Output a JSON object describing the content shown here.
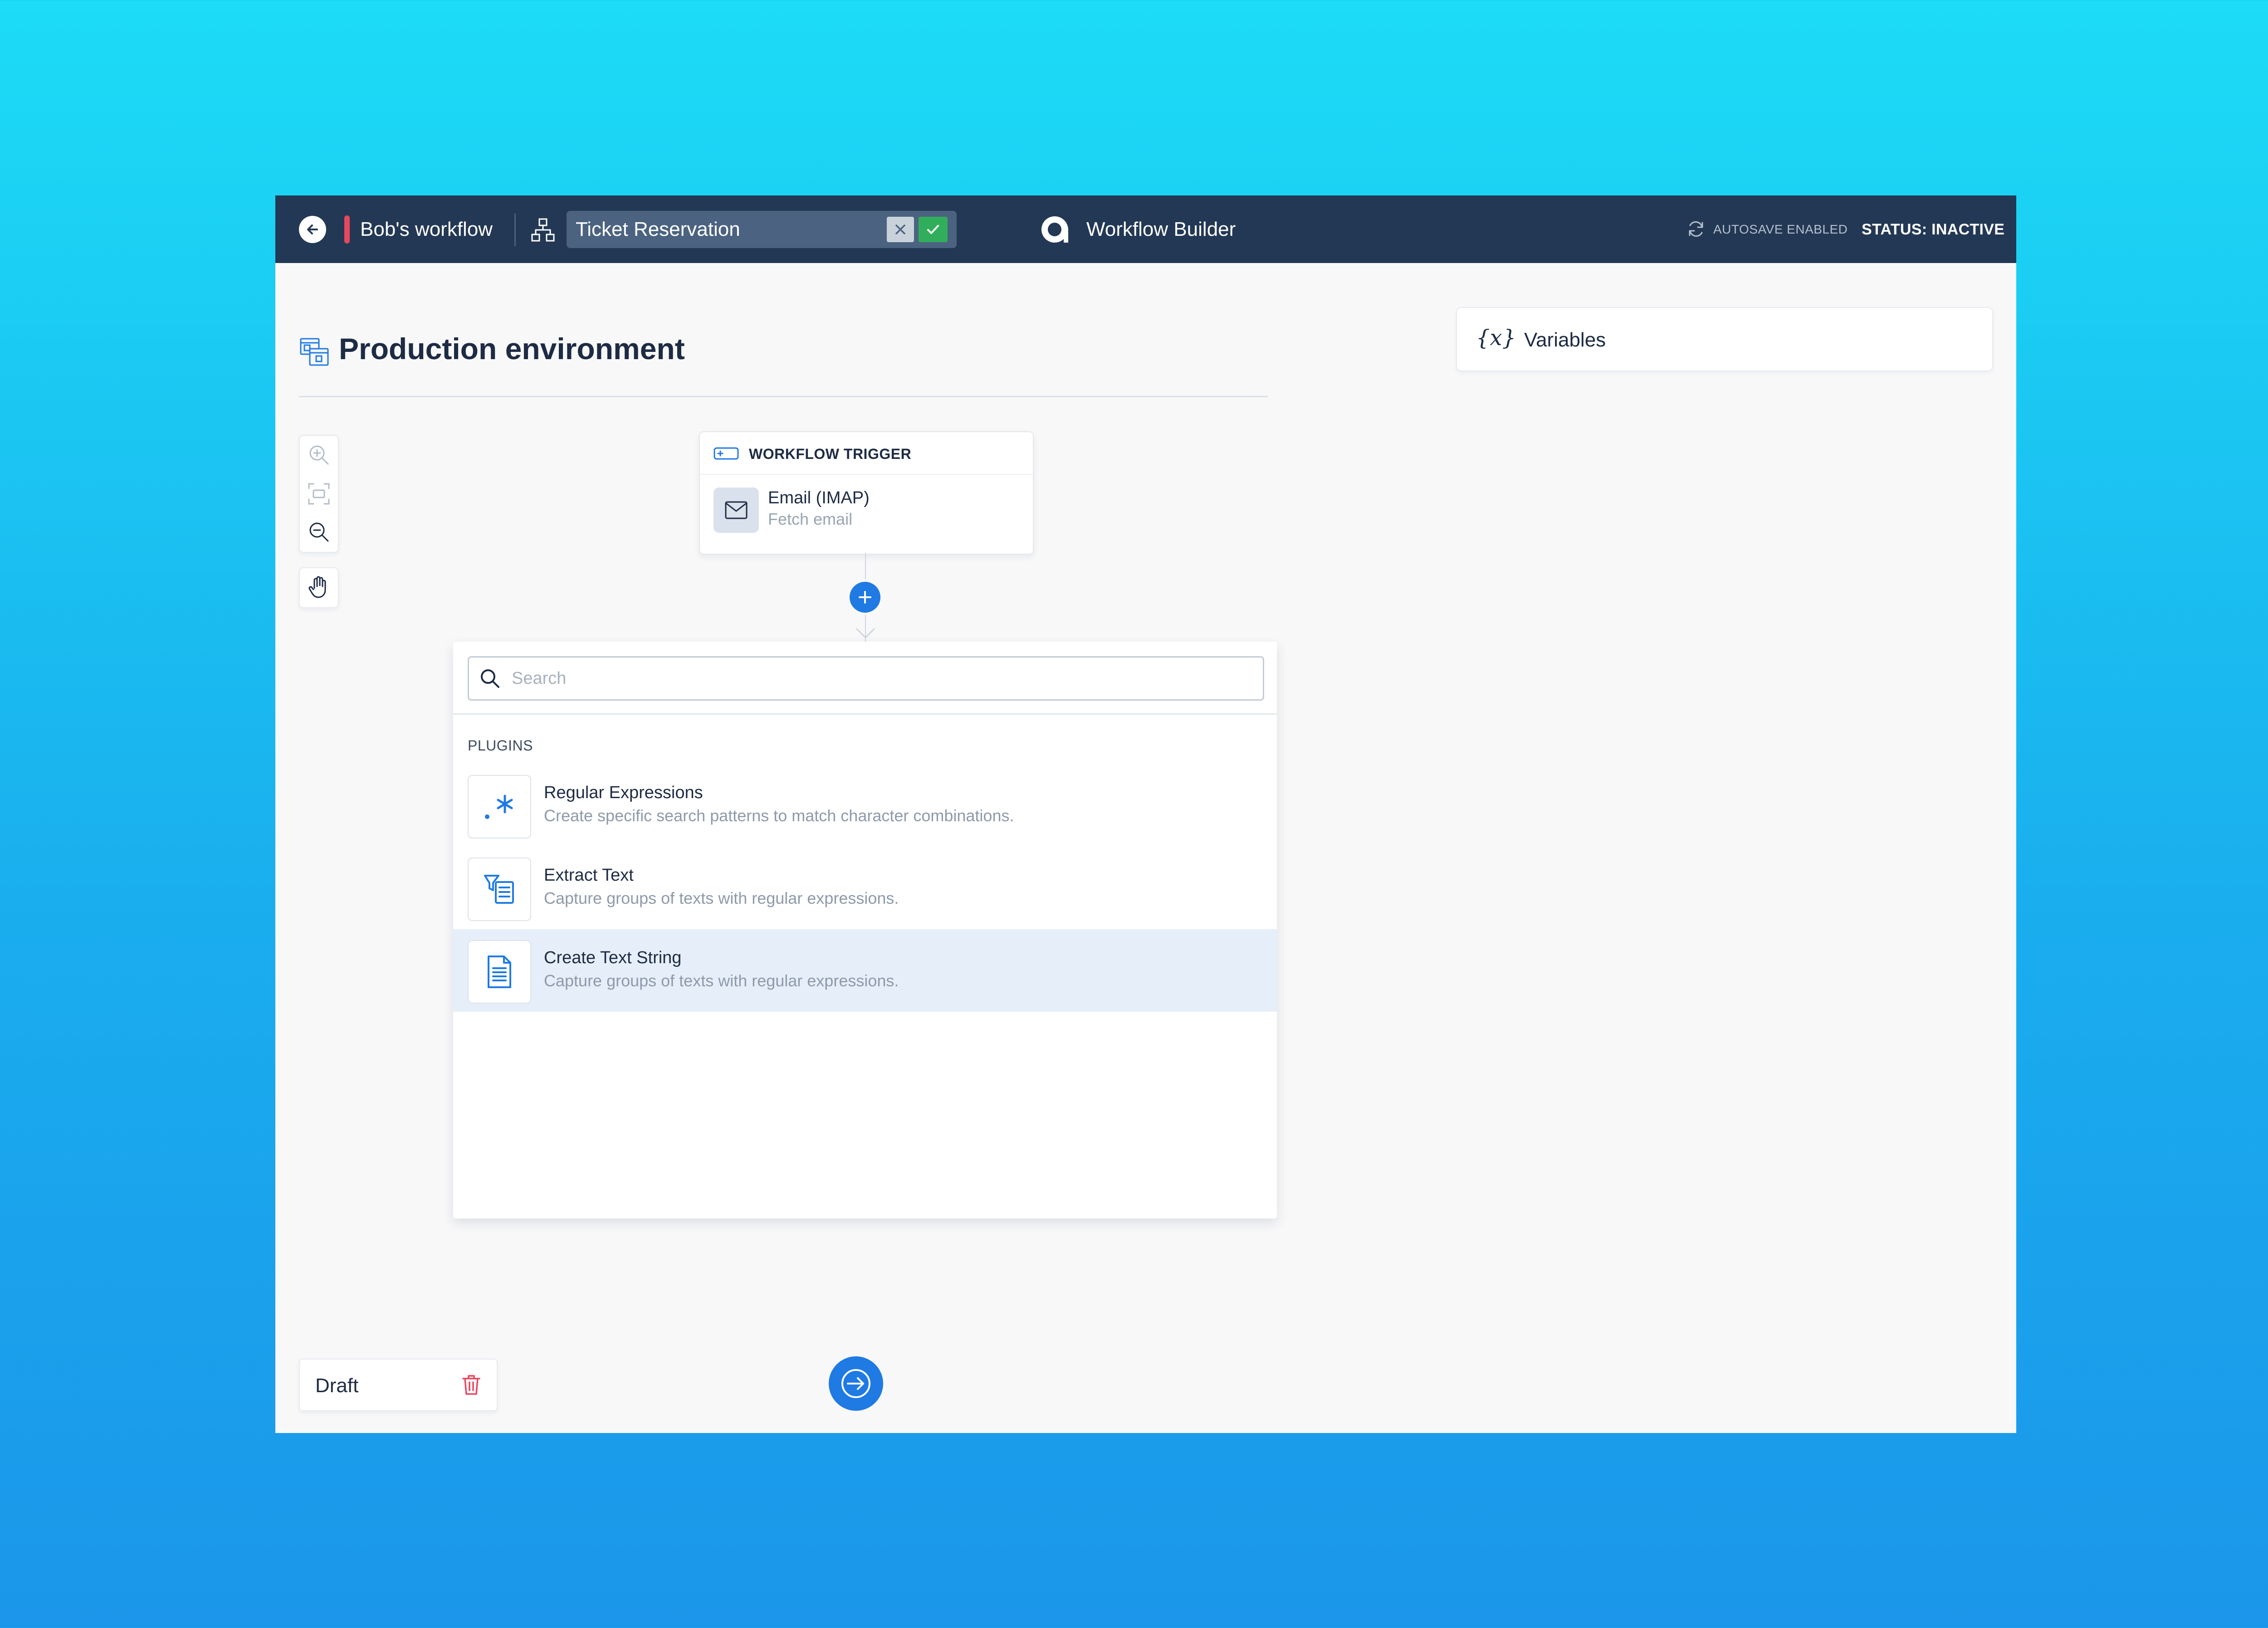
{
  "topbar": {
    "workflow_name": "Bob's workflow",
    "name_input_value": "Ticket Reservation",
    "app_title": "Workflow Builder",
    "autosave": "AUTOSAVE ENABLED",
    "status": "STATUS: INACTIVE"
  },
  "page": {
    "title": "Production environment"
  },
  "variables": {
    "icon_text": "{x}",
    "label": "Variables"
  },
  "trigger": {
    "header": "WORKFLOW TRIGGER",
    "name": "Email (IMAP)",
    "subtitle": "Fetch email"
  },
  "dropdown": {
    "search_placeholder": "Search",
    "section_label": "PLUGINS",
    "plugins": [
      {
        "name": "Regular Expressions",
        "description": "Create specific search patterns to match character combinations.",
        "icon": "regex-icon"
      },
      {
        "name": "Extract Text",
        "description": "Capture groups of texts with regular expressions.",
        "icon": "extract-text-icon"
      },
      {
        "name": "Create Text String",
        "description": "Capture groups of texts with regular expressions.",
        "icon": "document-icon",
        "highlighted": true
      }
    ]
  },
  "footer": {
    "draft_label": "Draft"
  },
  "colors": {
    "topbar": "#233854",
    "accent": "#1f7ae3",
    "success": "#31ae5c",
    "danger": "#e8475d",
    "background": "#f8f8f9"
  }
}
